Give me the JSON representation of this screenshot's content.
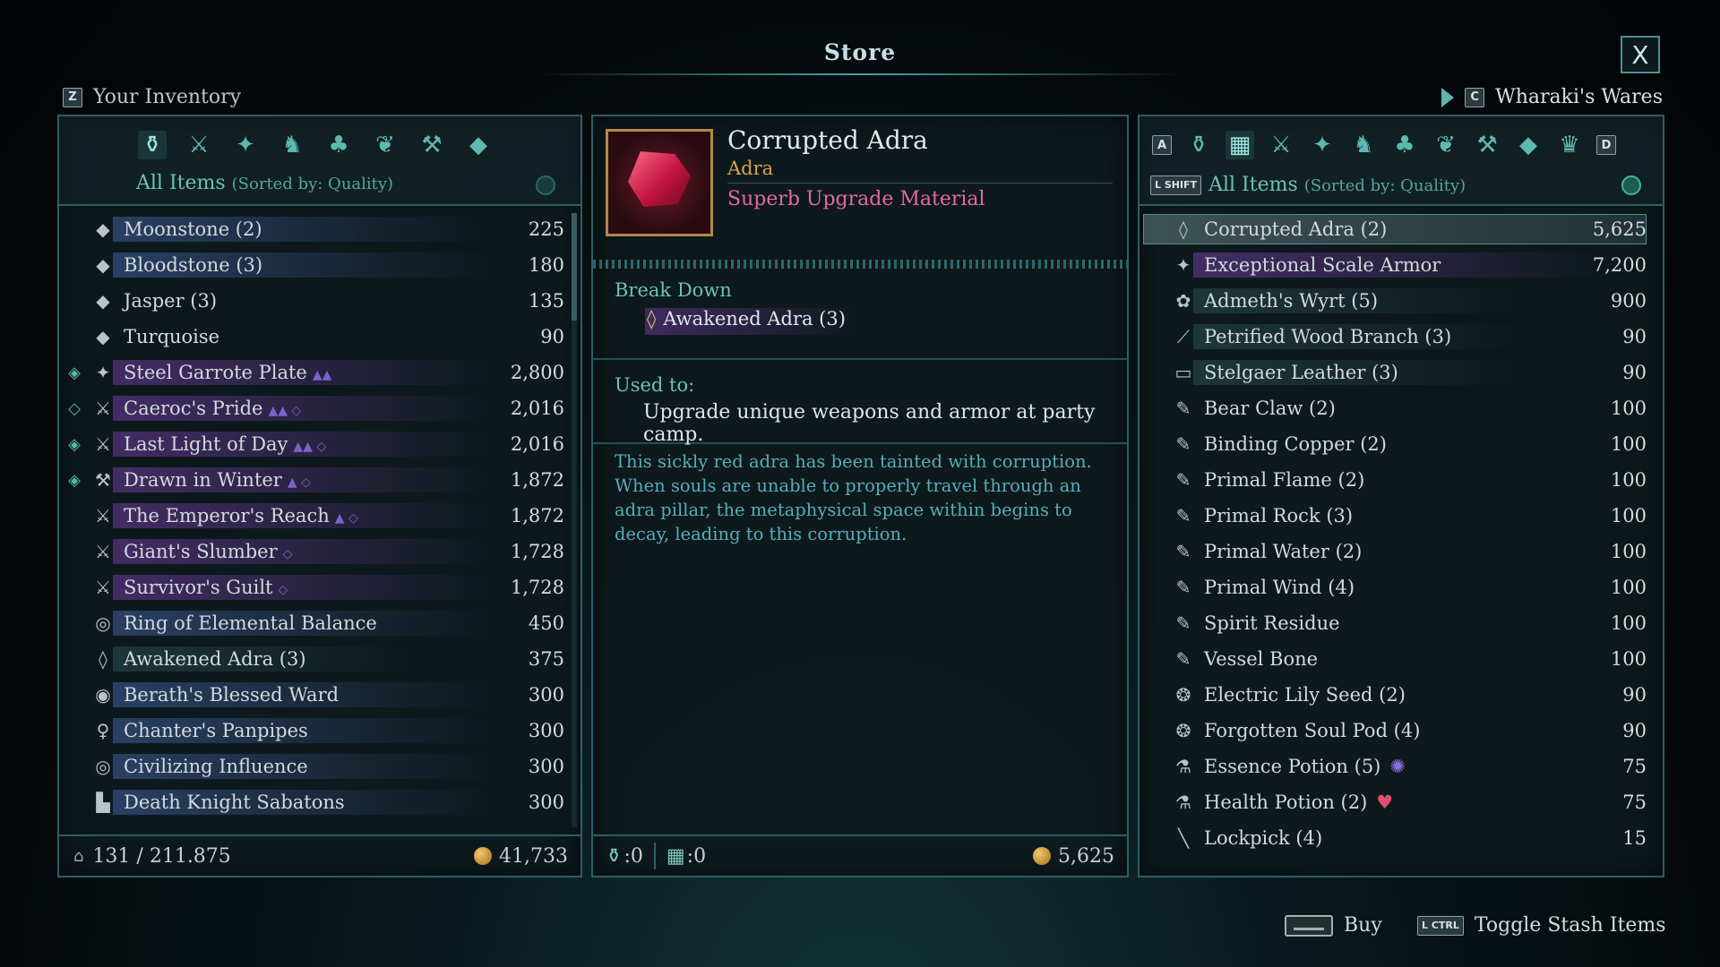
{
  "store": {
    "title": "Store",
    "close_label": "X"
  },
  "inventory": {
    "key": "Z",
    "title": "Your Inventory",
    "filter_label": "All Items",
    "filter_sub": "(Sorted by: Quality)",
    "weight": "131 / 211.875",
    "money": "41,733",
    "items": [
      {
        "name": "Moonstone (2)",
        "price": "225",
        "icon": "gem-icon",
        "glyph": "◆",
        "bar": "blue",
        "mark": "",
        "tag": ""
      },
      {
        "name": "Bloodstone (3)",
        "price": "180",
        "icon": "gem-icon",
        "glyph": "◆",
        "bar": "blue",
        "mark": "",
        "tag": ""
      },
      {
        "name": "Jasper (3)",
        "price": "135",
        "icon": "gem-icon",
        "glyph": "◆",
        "bar": "none",
        "mark": "",
        "tag": ""
      },
      {
        "name": "Turquoise",
        "price": "90",
        "icon": "gem-icon",
        "glyph": "◆",
        "bar": "none",
        "mark": "",
        "tag": ""
      },
      {
        "name": "Steel Garrote Plate",
        "price": "2,800",
        "icon": "armor-icon",
        "glyph": "✦",
        "bar": "purple",
        "mark": "◈",
        "tag": "▲▲"
      },
      {
        "name": "Caeroc's Pride",
        "price": "2,016",
        "icon": "sword-icon",
        "glyph": "⚔",
        "bar": "purple",
        "mark": "◇",
        "tag": "▲▲ ◇"
      },
      {
        "name": "Last Light of Day",
        "price": "2,016",
        "icon": "sword-icon",
        "glyph": "⚔",
        "bar": "purple",
        "mark": "◈",
        "tag": "▲▲ ◇"
      },
      {
        "name": "Drawn in Winter",
        "price": "1,872",
        "icon": "axe-icon",
        "glyph": "⚒",
        "bar": "purple",
        "mark": "◈",
        "tag": "▲ ◇"
      },
      {
        "name": "The Emperor's Reach",
        "price": "1,872",
        "icon": "spear-icon",
        "glyph": "⚔",
        "bar": "purple",
        "mark": "",
        "tag": "▲ ◇"
      },
      {
        "name": "Giant's Slumber",
        "price": "1,728",
        "icon": "sword-icon",
        "glyph": "⚔",
        "bar": "purple",
        "mark": "",
        "tag": "◇"
      },
      {
        "name": "Survivor's Guilt",
        "price": "1,728",
        "icon": "dagger-icon",
        "glyph": "⚔",
        "bar": "purple",
        "mark": "",
        "tag": "◇"
      },
      {
        "name": "Ring of Elemental Balance",
        "price": "450",
        "icon": "ring-icon",
        "glyph": "◎",
        "bar": "blue",
        "mark": "",
        "tag": ""
      },
      {
        "name": "Awakened Adra (3)",
        "price": "375",
        "icon": "adra-icon",
        "glyph": "◊",
        "bar": "teal",
        "mark": "",
        "tag": ""
      },
      {
        "name": "Berath's Blessed Ward",
        "price": "300",
        "icon": "amulet-icon",
        "glyph": "◉",
        "bar": "blue",
        "mark": "",
        "tag": ""
      },
      {
        "name": "Chanter's Panpipes",
        "price": "300",
        "icon": "pendant-icon",
        "glyph": "♀",
        "bar": "blue",
        "mark": "",
        "tag": ""
      },
      {
        "name": "Civilizing Influence",
        "price": "300",
        "icon": "ring-icon",
        "glyph": "◎",
        "bar": "blue",
        "mark": "",
        "tag": ""
      },
      {
        "name": "Death Knight Sabatons",
        "price": "300",
        "icon": "boots-icon",
        "glyph": "▙",
        "bar": "blue",
        "mark": "",
        "tag": ""
      }
    ]
  },
  "detail": {
    "name": "Corrupted Adra",
    "type": "Adra",
    "quality": "Superb Upgrade Material",
    "breakdown_head": "Break Down",
    "breakdown_item": "Awakened Adra (3)",
    "used_head": "Used to:",
    "used_text": "Upgrade unique weapons and armor at party camp.",
    "lore": "This sickly red adra has been tainted with corruption. When souls are unable to properly travel through an adra pillar, the metaphysical space within begins to decay, leading to this corruption.",
    "count_bag": ":0",
    "count_stash": ":0",
    "price": "5,625"
  },
  "vendor": {
    "key": "C",
    "name": "Wharaki's Wares",
    "key_a": "A",
    "key_d": "D",
    "shift_label": "L SHIFT",
    "filter_label": "All Items",
    "filter_sub": "(Sorted by: Quality)",
    "items": [
      {
        "name": "Corrupted Adra (2)",
        "price": "5,625",
        "icon": "adra-icon",
        "glyph": "◊",
        "bar": "selected",
        "extra": ""
      },
      {
        "name": "Exceptional Scale Armor",
        "price": "7,200",
        "icon": "armor-icon",
        "glyph": "✦",
        "bar": "purple",
        "extra": ""
      },
      {
        "name": "Admeth's Wyrt (5)",
        "price": "900",
        "icon": "herb-icon",
        "glyph": "✿",
        "bar": "teal",
        "extra": ""
      },
      {
        "name": "Petrified Wood Branch (3)",
        "price": "90",
        "icon": "branch-icon",
        "glyph": "⟋",
        "bar": "teal",
        "extra": ""
      },
      {
        "name": "Stelgaer Leather (3)",
        "price": "90",
        "icon": "leather-icon",
        "glyph": "▭",
        "bar": "teal",
        "extra": ""
      },
      {
        "name": "Bear Claw (2)",
        "price": "100",
        "icon": "scroll-icon",
        "glyph": "✎",
        "bar": "none",
        "extra": ""
      },
      {
        "name": "Binding Copper (2)",
        "price": "100",
        "icon": "scroll-icon",
        "glyph": "✎",
        "bar": "none",
        "extra": ""
      },
      {
        "name": "Primal Flame (2)",
        "price": "100",
        "icon": "scroll-icon",
        "glyph": "✎",
        "bar": "none",
        "extra": ""
      },
      {
        "name": "Primal Rock (3)",
        "price": "100",
        "icon": "scroll-icon",
        "glyph": "✎",
        "bar": "none",
        "extra": ""
      },
      {
        "name": "Primal Water (2)",
        "price": "100",
        "icon": "scroll-icon",
        "glyph": "✎",
        "bar": "none",
        "extra": ""
      },
      {
        "name": "Primal Wind (4)",
        "price": "100",
        "icon": "scroll-icon",
        "glyph": "✎",
        "bar": "none",
        "extra": ""
      },
      {
        "name": "Spirit Residue",
        "price": "100",
        "icon": "scroll-icon",
        "glyph": "✎",
        "bar": "none",
        "extra": ""
      },
      {
        "name": "Vessel Bone",
        "price": "100",
        "icon": "scroll-icon",
        "glyph": "✎",
        "bar": "none",
        "extra": ""
      },
      {
        "name": "Electric Lily Seed (2)",
        "price": "90",
        "icon": "seed-icon",
        "glyph": "❂",
        "bar": "none",
        "extra": ""
      },
      {
        "name": "Forgotten Soul Pod (4)",
        "price": "90",
        "icon": "seed-icon",
        "glyph": "❂",
        "bar": "none",
        "extra": ""
      },
      {
        "name": "Essence Potion (5)",
        "price": "75",
        "icon": "potion-icon",
        "glyph": "⚗",
        "bar": "none",
        "extra": "swirl"
      },
      {
        "name": "Health Potion (2)",
        "price": "75",
        "icon": "potion-icon",
        "glyph": "⚗",
        "bar": "none",
        "extra": "heart"
      },
      {
        "name": "Lockpick (4)",
        "price": "15",
        "icon": "lockpick-icon",
        "glyph": "╲",
        "bar": "none",
        "extra": ""
      }
    ]
  },
  "hints": {
    "buy_label": "Buy",
    "lctrl_key": "L CTRL",
    "toggle_label": "Toggle Stash Items"
  }
}
